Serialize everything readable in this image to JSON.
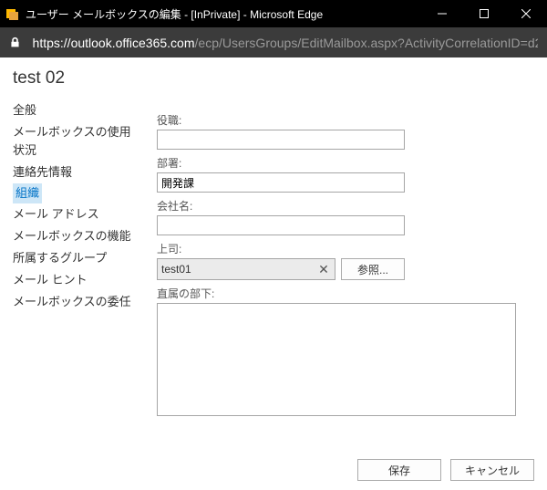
{
  "window": {
    "title": "ユーザー メールボックスの編集 - [InPrivate] - Microsoft Edge"
  },
  "address": {
    "host": "https://outlook.office365.com",
    "path": "/ecp/UsersGroups/EditMailbox.aspx?ActivityCorrelationID=d2..."
  },
  "page": {
    "title": "test 02"
  },
  "sidebar": {
    "items": [
      {
        "label": "全般"
      },
      {
        "label": "メールボックスの使用状況"
      },
      {
        "label": "連絡先情報"
      },
      {
        "label": "組織",
        "active": true
      },
      {
        "label": "メール アドレス"
      },
      {
        "label": "メールボックスの機能"
      },
      {
        "label": "所属するグループ"
      },
      {
        "label": "メール ヒント"
      },
      {
        "label": "メールボックスの委任"
      }
    ]
  },
  "form": {
    "title_label": "役職:",
    "title_value": "",
    "department_label": "部署:",
    "department_value": "開発課",
    "company_label": "会社名:",
    "company_value": "",
    "manager_label": "上司:",
    "manager_value": "test01",
    "browse_label": "参照...",
    "directreports_label": "直属の部下:",
    "directreports_value": ""
  },
  "footer": {
    "save": "保存",
    "cancel": "キャンセル"
  }
}
